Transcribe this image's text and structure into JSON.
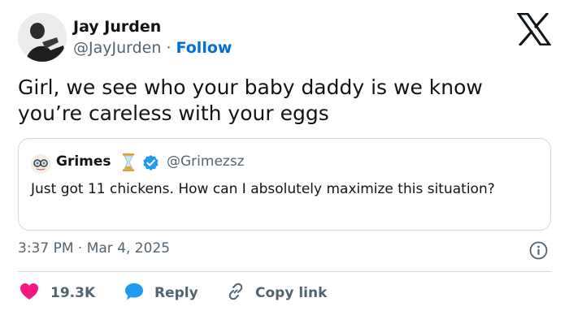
{
  "author": {
    "name": "Jay Jurden",
    "handle": "@JayJurden",
    "separator": "·",
    "follow_label": "Follow"
  },
  "tweet": {
    "text": "Girl, we see who your baby daddy is we know you’re careless with your eggs",
    "timestamp": "3:37 PM · Mar 4, 2025"
  },
  "quoted": {
    "name": "Grimes",
    "handle": "@Grimezsz",
    "text": "Just got 11 chickens.  How can I absolutely maximize this situation?",
    "verified": true,
    "badge_icon": "hourglass-icon"
  },
  "actions": {
    "like_count": "19.3K",
    "reply_label": "Reply",
    "copy_link_label": "Copy link"
  },
  "colors": {
    "like": "#f91880",
    "reply": "#1d9bf0",
    "link": "#006fd6",
    "secondary_text": "#536471",
    "border": "#cfd9de"
  }
}
